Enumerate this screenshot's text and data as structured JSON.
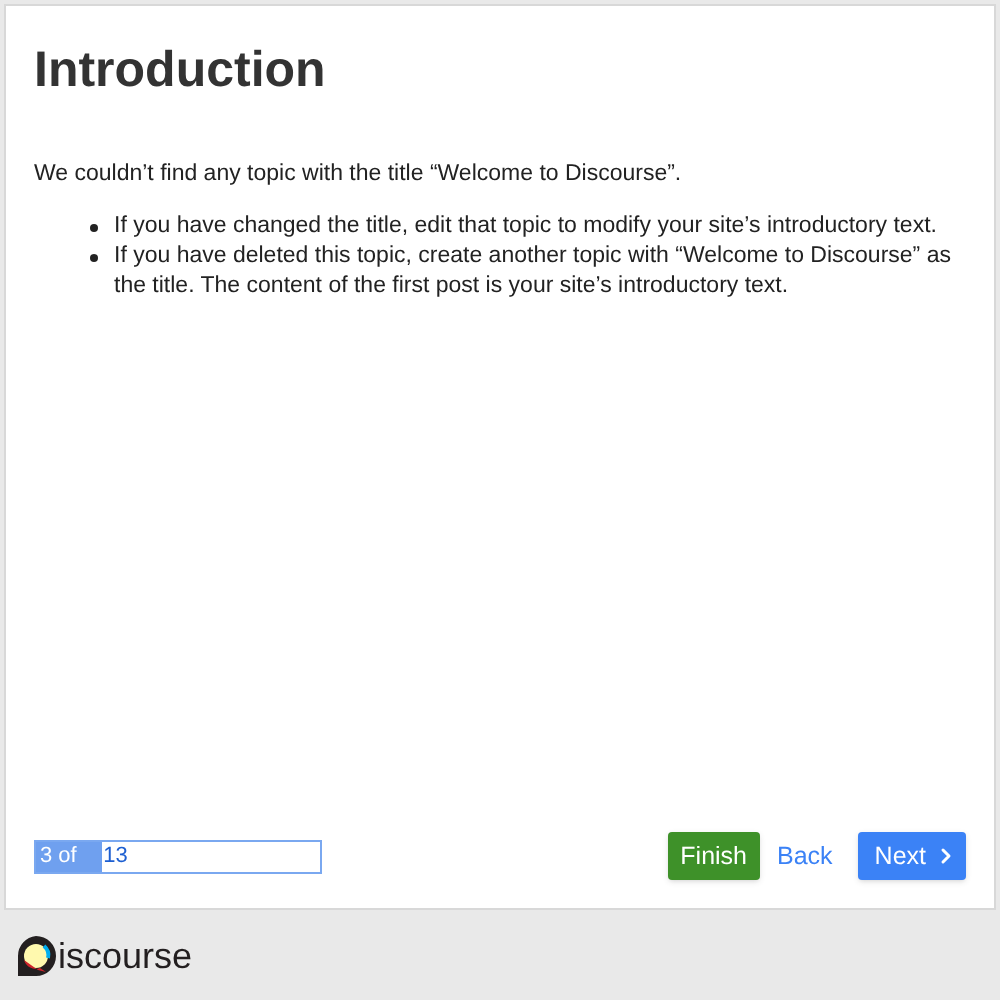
{
  "title": "Introduction",
  "intro": "We couldn’t find any topic with the title “Welcome to Discourse”.",
  "bullets": [
    "If you have changed the title, edit that topic to modify your site’s introductory text.",
    "If you have deleted this topic, create another topic with “Welcome to Discourse” as the title. The content of the first post is your site’s introductory text."
  ],
  "progress": {
    "current": "3 of",
    "total": "13",
    "level": 0.23
  },
  "buttons": {
    "finish": "Finish",
    "back": "Back",
    "next": "Next"
  },
  "footer": {
    "logo_text": "iscourse"
  }
}
